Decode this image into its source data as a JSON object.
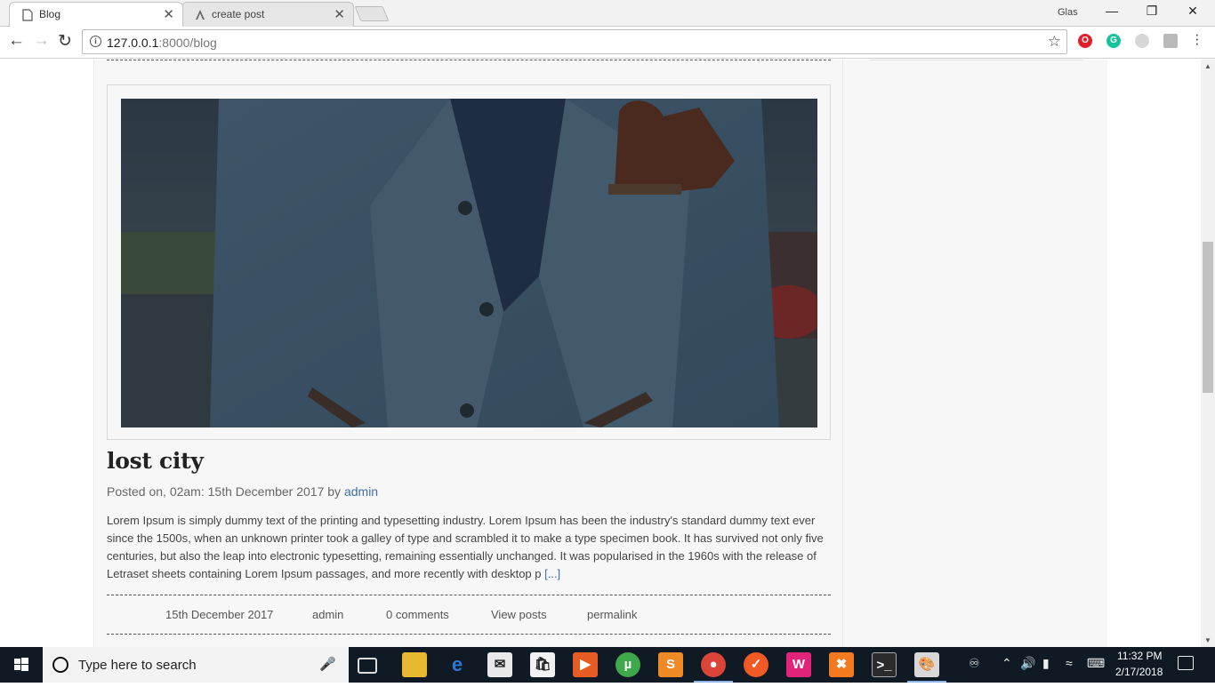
{
  "browser": {
    "tabs": [
      {
        "label": "Blog",
        "close": "✕"
      },
      {
        "label": "create post",
        "close": "✕"
      }
    ],
    "user_label": "Glas",
    "window_controls": {
      "minimize": "—",
      "restore": "❐",
      "close": "✕"
    },
    "url_host": "127.0.0.1",
    "url_path": ":8000/blog",
    "icons": [
      "back-arrow-icon",
      "forward-arrow-icon",
      "reload-icon",
      "info-icon",
      "star-icon",
      "opera-icon",
      "grammarly-icon",
      "extension-icon",
      "pdf-icon",
      "menu-icon"
    ]
  },
  "post": {
    "title": "lost city",
    "meta_prefix": "Posted on, 02am: 15th December 2017 by ",
    "author": "admin",
    "excerpt": "Lorem Ipsum is simply dummy text of the printing and typesetting industry. Lorem Ipsum has been the industry's standard dummy text ever since the 1500s, when an unknown printer took a galley of type and scrambled it to make a type specimen book. It has survived not only five centuries, but also the leap into electronic typesetting, remaining essentially unchanged. It was popularised in the 1960s with the release of Letraset sheets containing Lorem Ipsum passages, and more recently with desktop p ",
    "read_more": "[...]",
    "footer": {
      "date": "15th December 2017",
      "author": "admin",
      "comments": "0 comments",
      "view_posts": "View posts",
      "permalink": "permalink"
    }
  },
  "taskbar": {
    "search_placeholder": "Type here to search",
    "time": "11:32 PM",
    "date": "2/17/2018"
  },
  "colors": {
    "link": "#3d6fa6",
    "page_bg": "#f7f7f7",
    "taskbar_bg": "#101a24"
  }
}
